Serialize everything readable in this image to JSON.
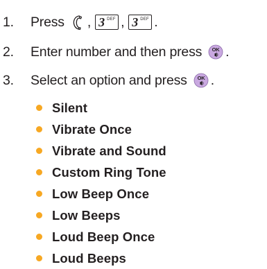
{
  "steps": [
    {
      "number": "1.",
      "text": "Press"
    },
    {
      "number": "2.",
      "text": "Enter number and then press"
    },
    {
      "number": "3.",
      "text": "Select an option and press"
    }
  ],
  "keys": {
    "three_digit": "3",
    "three_letters": "DEF",
    "separator": ",",
    "end_mark": "."
  },
  "options": [
    "Silent",
    "Vibrate Once",
    "Vibrate and Sound",
    "Custom Ring Tone",
    "Low Beep Once",
    "Low Beeps",
    "Loud Beep Once",
    "Loud Beeps"
  ],
  "colors": {
    "bullet": "#f7a823",
    "ok_key": "#c9a8e0",
    "text": "#231f20"
  },
  "icons": {
    "send": "send-key-icon",
    "digit": "key-3-def-icon",
    "ok": "ok-key-icon"
  }
}
